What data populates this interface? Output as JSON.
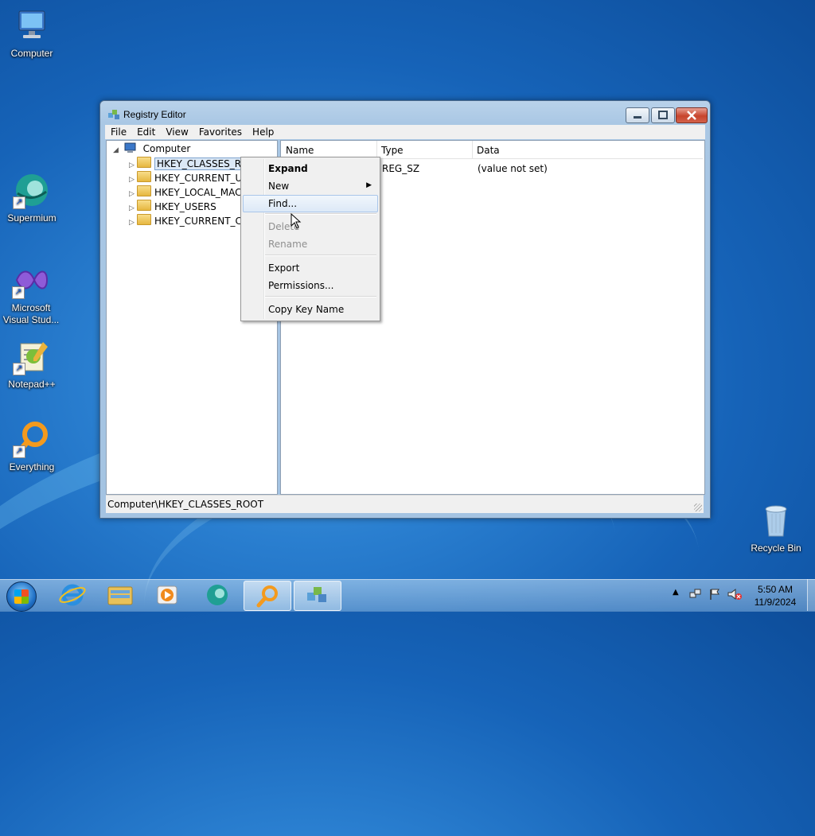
{
  "desktop": {
    "icons": [
      {
        "label": "Computer"
      },
      {
        "label": "Supermium"
      },
      {
        "label": "Microsoft Visual Stud..."
      },
      {
        "label": "Notepad++"
      },
      {
        "label": "Everything"
      },
      {
        "label": "Recycle Bin"
      }
    ]
  },
  "window": {
    "title": "Registry Editor",
    "menu": [
      "File",
      "Edit",
      "View",
      "Favorites",
      "Help"
    ],
    "tree": {
      "root": "Computer",
      "keys": [
        "HKEY_CLASSES_ROOT",
        "HKEY_CURRENT_US",
        "HKEY_LOCAL_MACI",
        "HKEY_USERS",
        "HKEY_CURRENT_CO"
      ]
    },
    "columns": [
      "Name",
      "Type",
      "Data"
    ],
    "values": [
      {
        "name": "",
        "type": "REG_SZ",
        "data": "(value not set)"
      }
    ],
    "status": "Computer\\HKEY_CLASSES_ROOT"
  },
  "context_menu": {
    "items": [
      "Expand",
      "New",
      "Find...",
      "Delete",
      "Rename",
      "Export",
      "Permissions...",
      "Copy Key Name"
    ]
  },
  "taskbar": {
    "time": "5:50 AM",
    "date": "11/9/2024"
  }
}
